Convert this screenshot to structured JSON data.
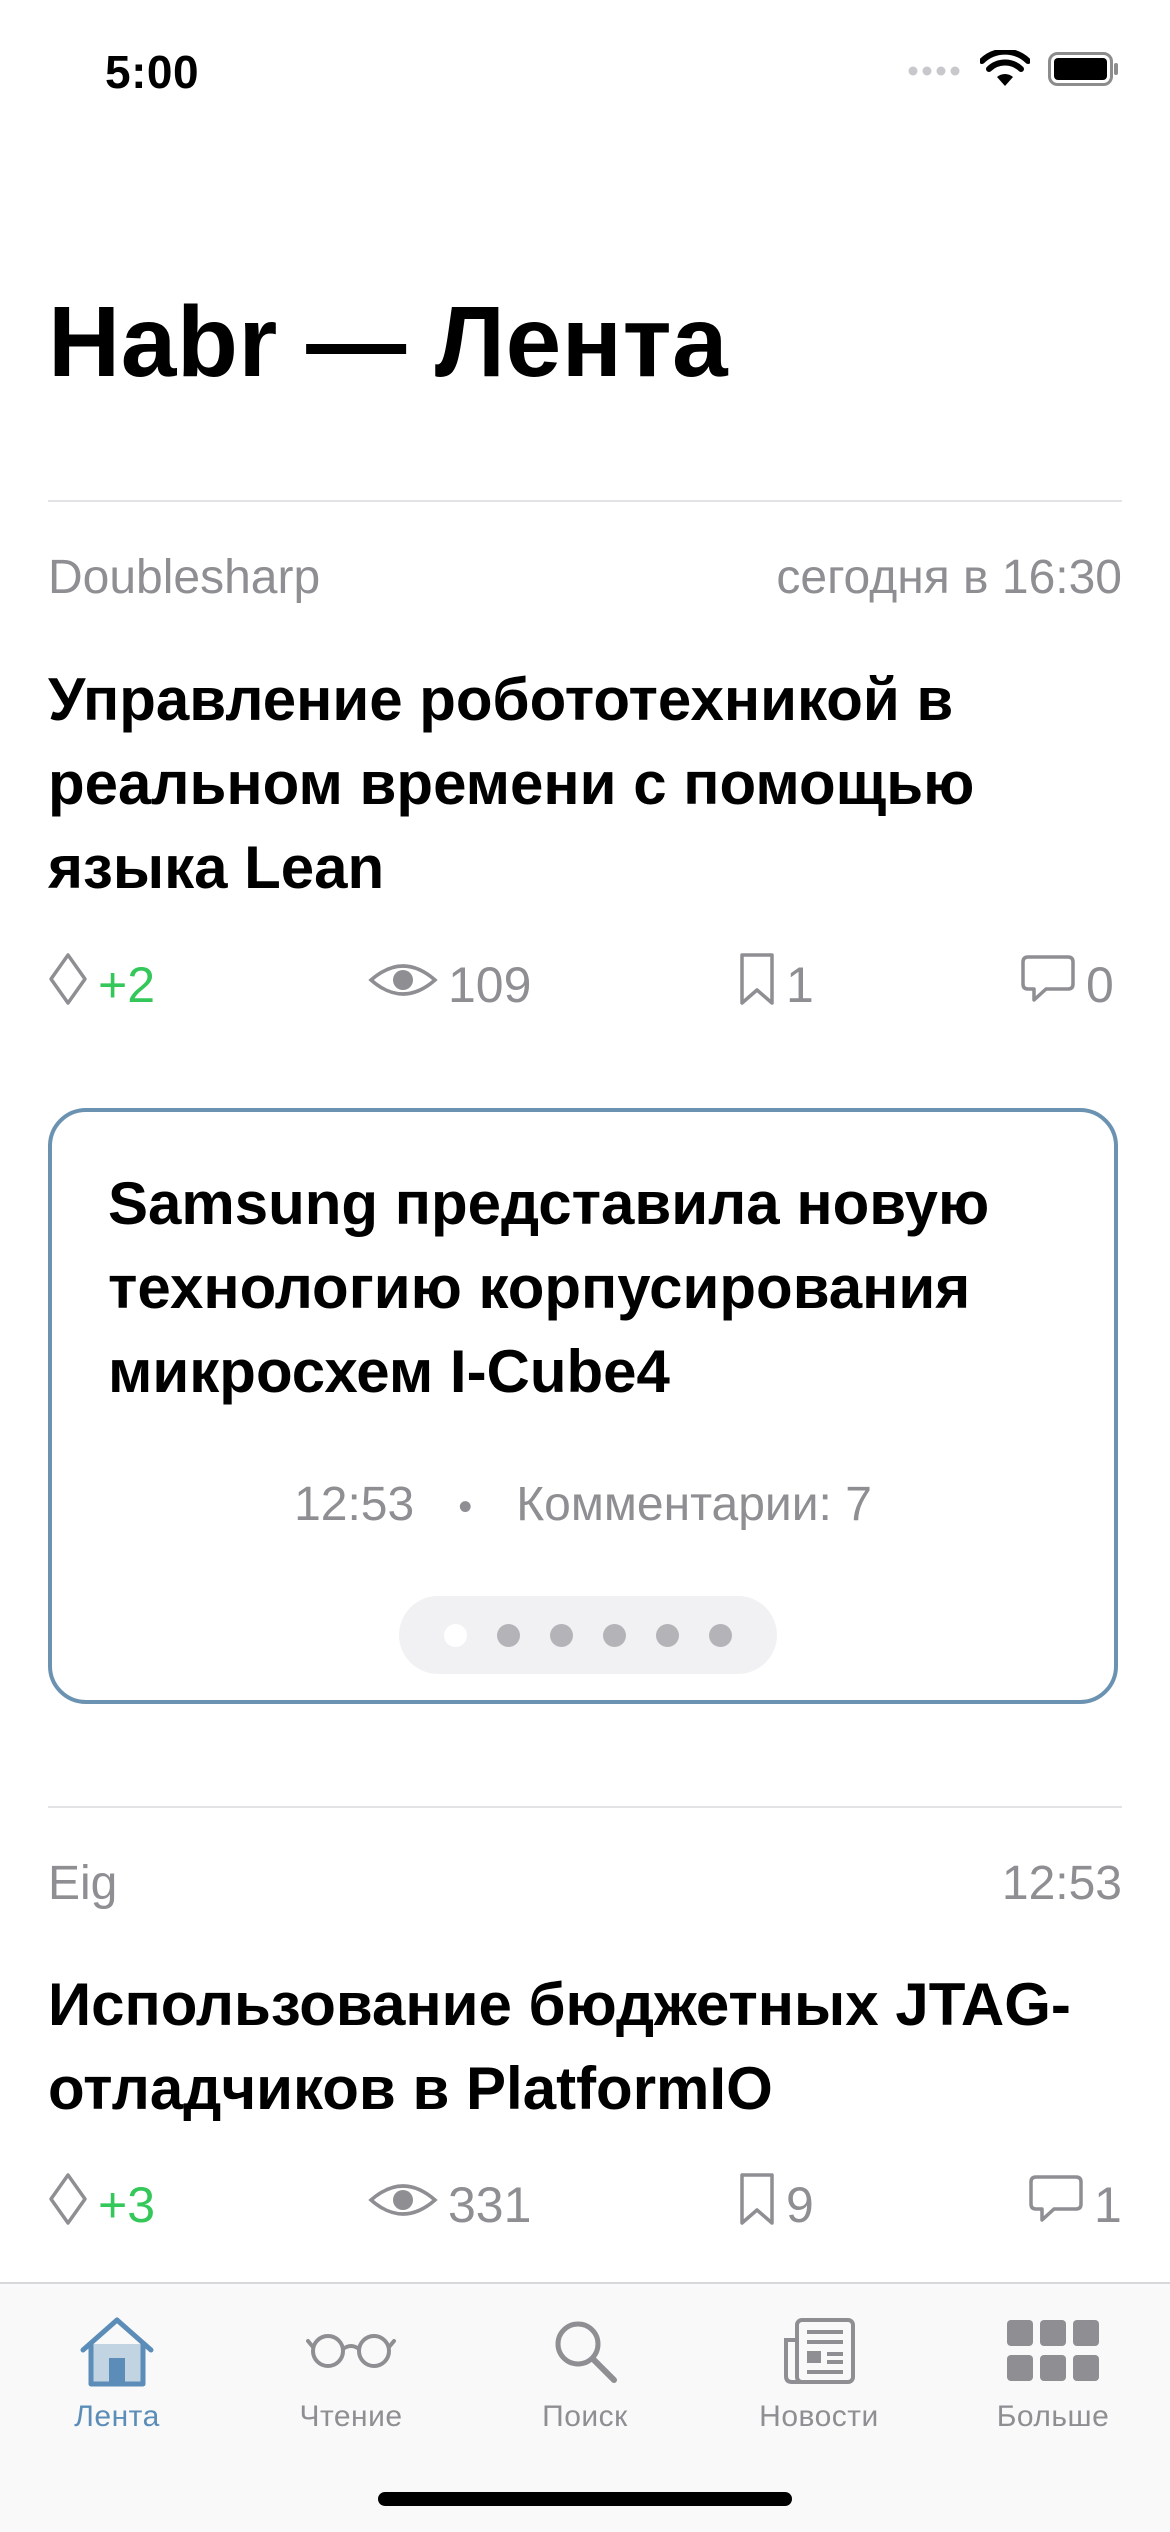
{
  "status_bar": {
    "time": "5:00"
  },
  "page_title": "Habr — Лента",
  "articles": [
    {
      "author": "Doublesharp",
      "date": "сегодня в 16:30",
      "title": "Управление робототехникой в реальном времени с помощью языка Lean",
      "rating": "+2",
      "views": "109",
      "bookmarks": "1",
      "comments": "0"
    },
    {
      "author": "Eig",
      "date": "12:53",
      "title": "Использование бюджетных JTAG-отладчиков в PlatformIO",
      "rating": "+3",
      "views": "331",
      "bookmarks": "9",
      "comments": "1"
    }
  ],
  "news_card": {
    "title": "Samsung представила новую технологию корпусирования микросхем I-Cube4",
    "time": "12:53",
    "comments": "Комментарии: 7",
    "page_count": 6,
    "active_page": 1
  },
  "tab_bar": {
    "items": [
      {
        "label": "Лента",
        "icon": "home-icon",
        "active": true
      },
      {
        "label": "Чтение",
        "icon": "glasses-icon",
        "active": false
      },
      {
        "label": "Поиск",
        "icon": "search-icon",
        "active": false
      },
      {
        "label": "Новости",
        "icon": "newspaper-icon",
        "active": false
      },
      {
        "label": "Больше",
        "icon": "grid-icon",
        "active": false
      }
    ]
  },
  "colors": {
    "accent": "#5b8db8",
    "positive": "#34c759",
    "secondary_text": "#8e8e93",
    "card_border": "#6b93b1"
  }
}
